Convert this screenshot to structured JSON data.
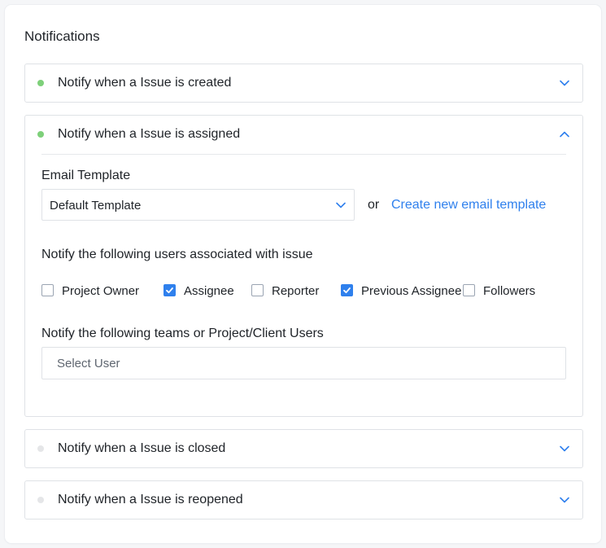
{
  "page": {
    "title": "Notifications"
  },
  "colors": {
    "active_dot": "#7ed07a",
    "inactive_dot": "#e5e6e8",
    "accent": "#2f80ed"
  },
  "panels": [
    {
      "title": "Notify when a Issue is created",
      "status": "active",
      "expanded": false
    },
    {
      "title": "Notify when a Issue is assigned",
      "status": "active",
      "expanded": true
    },
    {
      "title": "Notify when a Issue is closed",
      "status": "inactive",
      "expanded": false
    },
    {
      "title": "Notify when a Issue is reopened",
      "status": "inactive",
      "expanded": false
    }
  ],
  "assigned": {
    "email_template_label": "Email Template",
    "template_select_value": "Default Template",
    "or_text": "or",
    "create_template_link": "Create new email template",
    "users_label": "Notify the following users associated with issue",
    "checkboxes": [
      {
        "label": "Project Owner",
        "checked": false
      },
      {
        "label": "Assignee",
        "checked": true
      },
      {
        "label": "Reporter",
        "checked": false
      },
      {
        "label": "Previous Assignee",
        "checked": true
      },
      {
        "label": "Followers",
        "checked": false
      }
    ],
    "teams_label": "Notify the following teams or Project/Client Users",
    "select_user_placeholder": "Select User"
  }
}
